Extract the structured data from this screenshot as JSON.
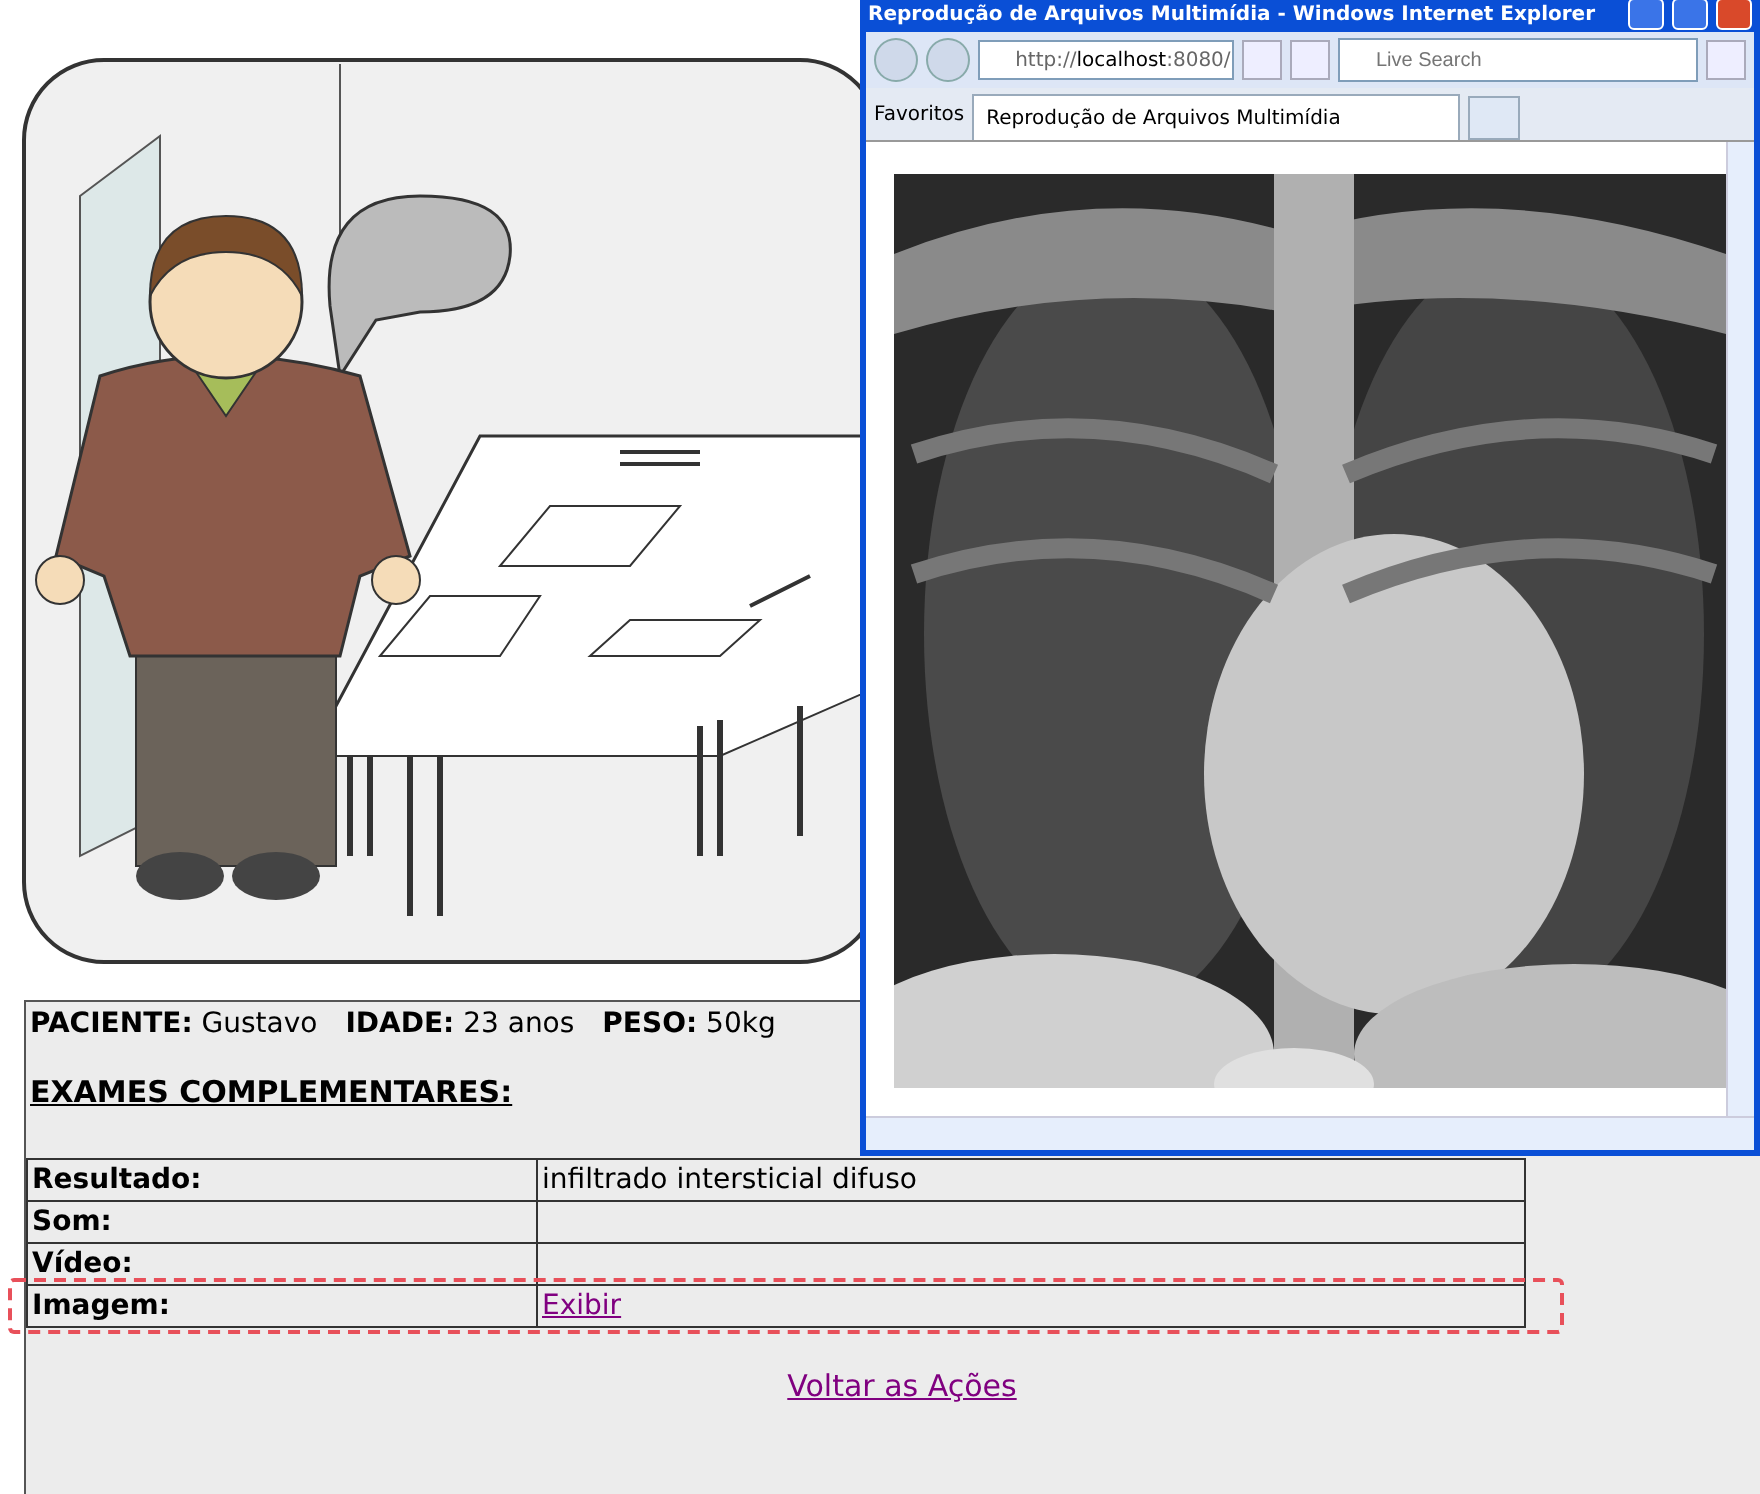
{
  "browser": {
    "title": "Reprodução de Arquivos Multimídia - Windows Internet Explorer",
    "address": "http://**localhost**:8080/",
    "search_placeholder": "Live Search",
    "favorites": "Favoritos",
    "tabs": [
      {
        "label": "Reprodução de Arquivos Multimídia",
        "selected": true
      }
    ]
  },
  "patient": [
    {
      "label": "PACIENTE:",
      "value": "Gustavo"
    },
    {
      "label": "IDADE:",
      "value": "23 anos"
    },
    {
      "label": "PESO:",
      "value": "50kg"
    }
  ],
  "section_title": "EXAMES COMPLEMENTARES:",
  "exams": [
    {
      "label": "Resultado:",
      "value": "infiltrado intersticial difuso",
      "highlighted": false
    },
    {
      "label": "Som:",
      "highlighted": false
    },
    {
      "label": "Vídeo:",
      "highlighted": false
    },
    {
      "label": "Imagem:",
      "link": "Exibir",
      "highlighted": true
    }
  ],
  "back_link": "Voltar as Ações"
}
